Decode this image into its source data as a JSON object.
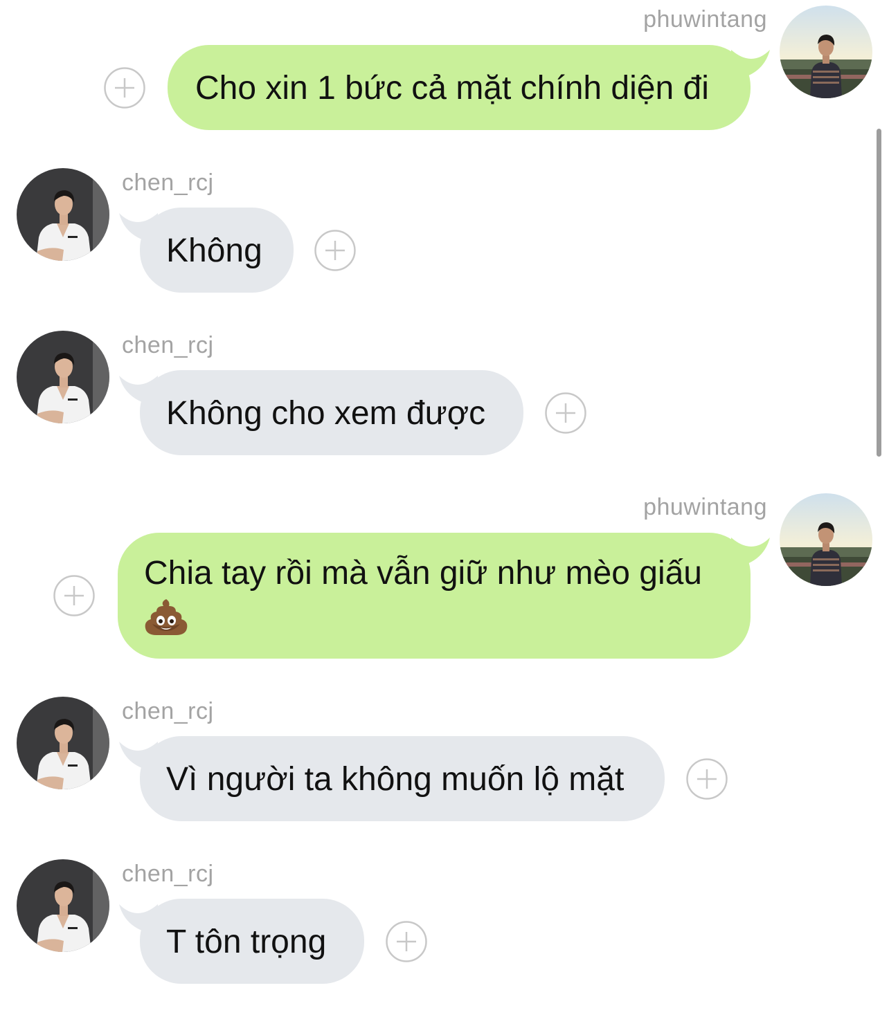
{
  "users": {
    "me": "phuwintang",
    "other": "chen_rcj"
  },
  "messages": [
    {
      "sender": "phuwintang",
      "direction": "out",
      "text": "Cho xin 1 bức cả mặt chính diện đi"
    },
    {
      "sender": "chen_rcj",
      "direction": "in",
      "text": "Không"
    },
    {
      "sender": "chen_rcj",
      "direction": "in",
      "text": "Không cho xem được"
    },
    {
      "sender": "phuwintang",
      "direction": "out",
      "text": "Chia tay rồi mà vẫn giữ như mèo giấu",
      "emoji": "pile-of-poo-icon"
    },
    {
      "sender": "chen_rcj",
      "direction": "in",
      "text": "Vì người ta không muốn lộ mặt"
    },
    {
      "sender": "chen_rcj",
      "direction": "in",
      "text": "T tôn trọng"
    }
  ],
  "colors": {
    "outgoing_bubble": "#c9f09a",
    "incoming_bubble": "#e5e8ec",
    "username": "#a3a3a3",
    "text": "#111111",
    "plus_icon": "#c8c8c8"
  }
}
